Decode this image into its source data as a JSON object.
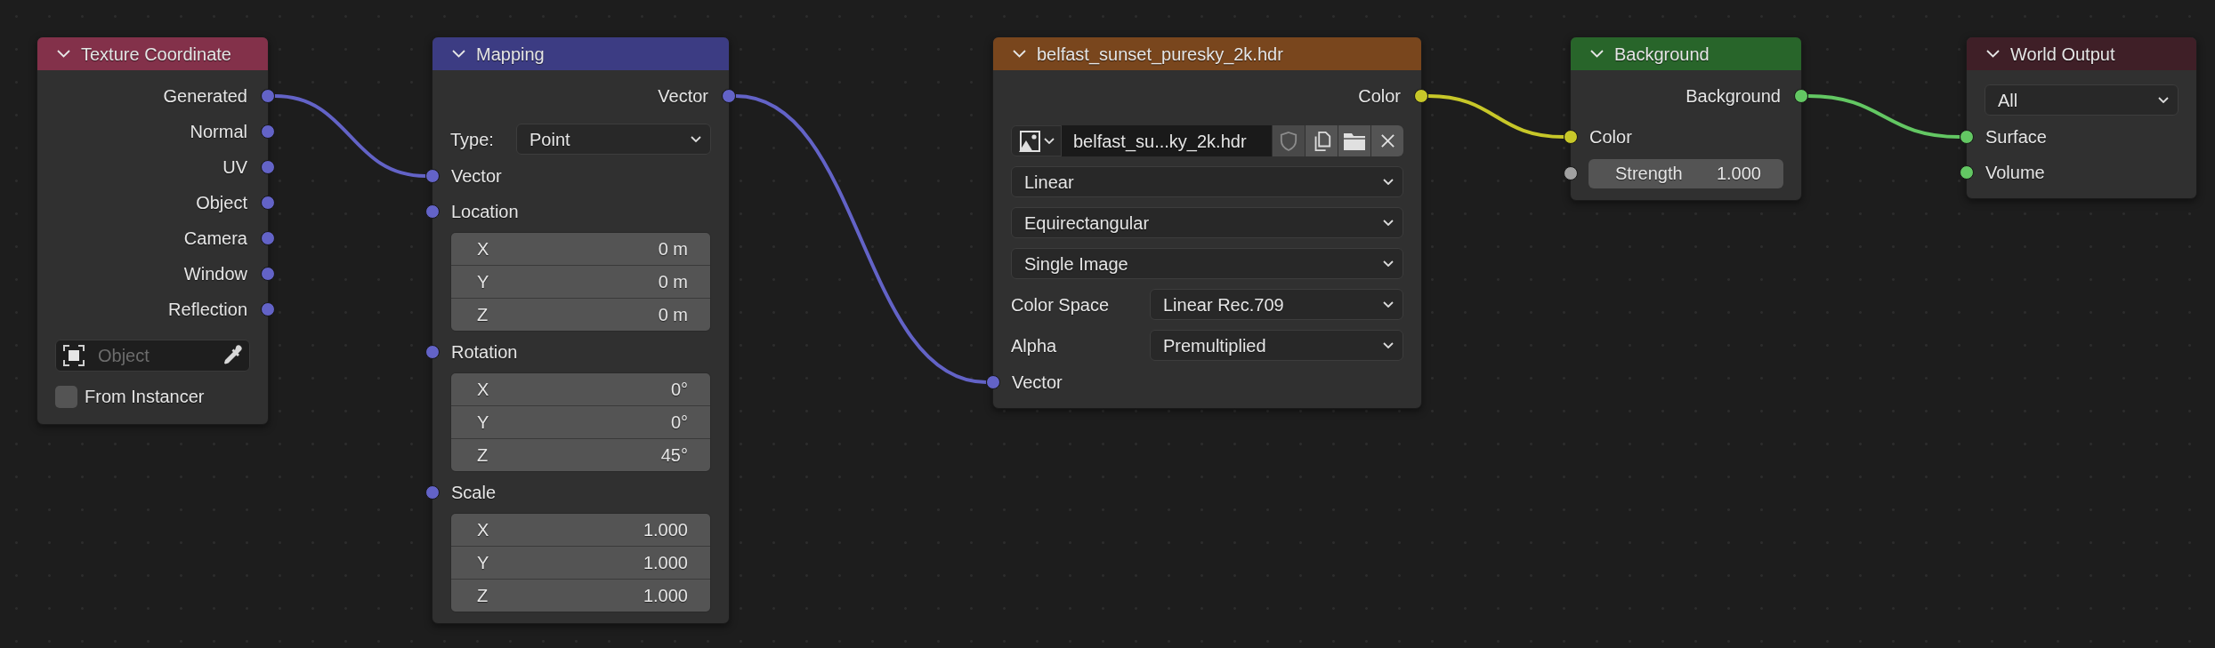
{
  "nodes": [
    {
      "title": "Texture Coordinate",
      "color": "#83314a",
      "rows": [
        {
          "kind": "output",
          "label": "Generated",
          "color": "#6363c7",
          "linked": true
        },
        {
          "kind": "output",
          "label": "Normal",
          "color": "#6363c7",
          "linked": false
        },
        {
          "kind": "output",
          "label": "UV",
          "color": "#6363c7",
          "linked": false
        },
        {
          "kind": "output",
          "label": "Object",
          "color": "#6363c7",
          "linked": false
        },
        {
          "kind": "output",
          "label": "Camera",
          "color": "#6363c7",
          "linked": false
        },
        {
          "kind": "output",
          "label": "Window",
          "color": "#6363c7",
          "linked": false
        },
        {
          "kind": "output",
          "label": "Reflection",
          "color": "#6363c7",
          "linked": false
        },
        {
          "kind": "object-field",
          "placeholder": "Object"
        },
        {
          "kind": "checkbox",
          "label": "From Instancer",
          "checked": false
        }
      ]
    },
    {
      "title": "Mapping",
      "color": "#3c3c83",
      "rows": [
        {
          "kind": "output",
          "label": "Vector",
          "color": "#6363c7",
          "linked": true
        },
        {
          "kind": "labeled-dropdown",
          "label": "Type:",
          "value": "Point"
        },
        {
          "kind": "input",
          "label": "Vector",
          "color": "#6363c7",
          "linked": true
        },
        {
          "kind": "input",
          "label": "Location",
          "color": "#6363c7",
          "linked": false
        },
        {
          "kind": "vector-fields",
          "fields": [
            {
              "axis": "X",
              "value": "0 m"
            },
            {
              "axis": "Y",
              "value": "0 m"
            },
            {
              "axis": "Z",
              "value": "0 m"
            }
          ]
        },
        {
          "kind": "input",
          "label": "Rotation",
          "color": "#6363c7",
          "linked": false
        },
        {
          "kind": "vector-fields",
          "fields": [
            {
              "axis": "X",
              "value": "0°"
            },
            {
              "axis": "Y",
              "value": "0°"
            },
            {
              "axis": "Z",
              "value": "45°"
            }
          ]
        },
        {
          "kind": "input",
          "label": "Scale",
          "color": "#6363c7",
          "linked": false
        },
        {
          "kind": "vector-fields",
          "fields": [
            {
              "axis": "X",
              "value": "1.000"
            },
            {
              "axis": "Y",
              "value": "1.000"
            },
            {
              "axis": "Z",
              "value": "1.000"
            }
          ]
        }
      ]
    },
    {
      "title": "belfast_sunset_puresky_2k.hdr",
      "color": "#79461d",
      "rows": [
        {
          "kind": "output",
          "label": "Color",
          "color": "#c7c729",
          "linked": true
        },
        {
          "kind": "image-selector",
          "filename": "belfast_su...ky_2k.hdr"
        },
        {
          "kind": "dropdown",
          "value": "Linear"
        },
        {
          "kind": "dropdown",
          "value": "Equirectangular"
        },
        {
          "kind": "dropdown",
          "value": "Single Image"
        },
        {
          "kind": "labeled-dropdown",
          "label": "Color Space",
          "value": "Linear Rec.709"
        },
        {
          "kind": "labeled-dropdown",
          "label": "Alpha",
          "value": "Premultiplied"
        },
        {
          "kind": "input",
          "label": "Vector",
          "color": "#6363c7",
          "linked": true
        }
      ]
    },
    {
      "title": "Background",
      "color": "#28652a",
      "rows": [
        {
          "kind": "output",
          "label": "Background",
          "color": "#63c763",
          "linked": true
        },
        {
          "kind": "input",
          "label": "Color",
          "color": "#c7c729",
          "linked": true
        },
        {
          "kind": "input-field",
          "label": "Strength",
          "value": "1.000",
          "color": "#a1a1a1",
          "linked": false
        }
      ]
    },
    {
      "title": "World Output",
      "color": "#3f1f27",
      "rows": [
        {
          "kind": "dropdown",
          "value": "All"
        },
        {
          "kind": "input",
          "label": "Surface",
          "color": "#63c763",
          "linked": true
        },
        {
          "kind": "input",
          "label": "Volume",
          "color": "#63c763",
          "linked": false
        }
      ]
    }
  ]
}
